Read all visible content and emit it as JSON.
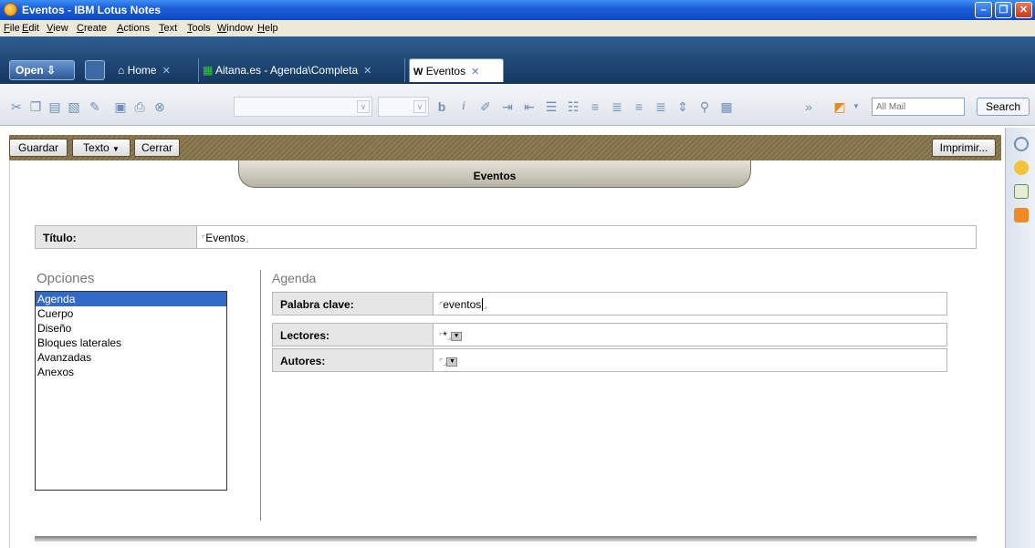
{
  "window": {
    "title": "Eventos - IBM Lotus Notes"
  },
  "menu": [
    "File",
    "Edit",
    "View",
    "Create",
    "Actions",
    "Text",
    "Tools",
    "Window",
    "Help"
  ],
  "tabs": {
    "open_label": "Open",
    "items": [
      {
        "label": "Home"
      },
      {
        "label": "Aitana.es - Agenda\\Completa"
      },
      {
        "label": "Eventos"
      }
    ]
  },
  "toolbar": {
    "bold": "b",
    "italic": "i",
    "search_placeholder": "All Mail",
    "search_label": "Search"
  },
  "actions": {
    "save": "Guardar",
    "text": "Texto",
    "text_arrow": "▼",
    "close": "Cerrar",
    "print": "Imprimir..."
  },
  "form": {
    "header": "Eventos",
    "title_label": "Título:",
    "title_value": "Eventos",
    "options_heading": "Opciones",
    "options": [
      "Agenda",
      "Cuerpo",
      "Diseño",
      "Bloques laterales",
      "Avanzadas",
      "Anexos"
    ],
    "selected_option": "Agenda",
    "section_heading": "Agenda",
    "keyword_label": "Palabra clave:",
    "keyword_value": "eventos",
    "readers_label": "Lectores:",
    "readers_value": "*",
    "authors_label": "Autores:",
    "authors_value": ""
  },
  "colors": {
    "title_blue": "#0a48c6",
    "tab_navy": "#14375f",
    "action_bar": "#8e7d55",
    "list_select": "#316ac5"
  }
}
